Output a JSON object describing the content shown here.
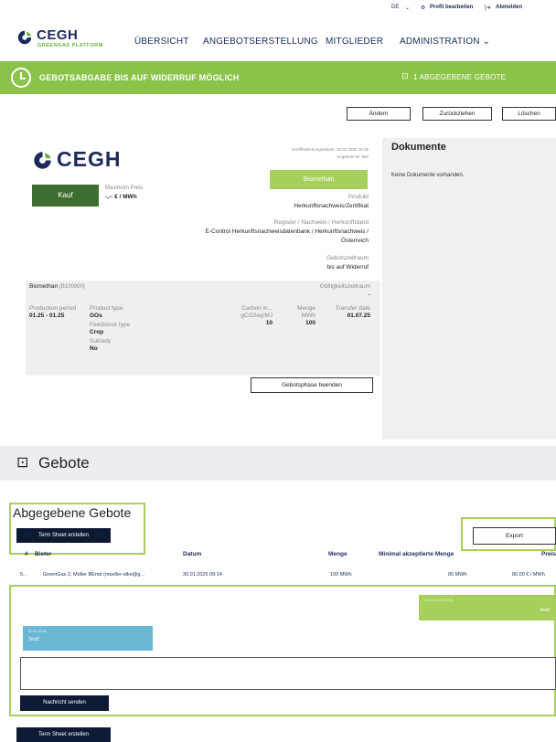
{
  "topbar": {
    "lang": "DE",
    "profile": "Profil bearbeiten",
    "logout": "Abmelden"
  },
  "brand": {
    "name": "CEGH",
    "sub": "GREENGAS PLATFORM",
    "primary": "#1c2a5a",
    "accent": "#8bc34a"
  },
  "nav": [
    "ÜBERSICHT",
    "ANGEBOTSERSTELLUNG",
    "MITGLIEDER",
    "ADMINISTRATION"
  ],
  "banner": {
    "title": "GEBOTSABGABE BIS AUF WIDERRUF MÖGLICH",
    "bids": "1 ABGEGEBENE GEBOTE"
  },
  "actions": {
    "edit": "Ändern",
    "withdraw": "Zurückziehen",
    "delete": "Löschen"
  },
  "offer": {
    "logo": "CEGH",
    "type": "Kauf",
    "max_price_label": "Maximum Preis",
    "max_price": "-,-- € / MWh",
    "published": "Veröffentlichungsdatum: 30.01.2025 16:39",
    "offer_id": "Angebots ID: 883",
    "product_tag": "Biomethan",
    "product_label": "Produkt",
    "product": "Herkunftsnachweis/Zertifikat",
    "register_label": "Register / Nachweis / Herkunftsland",
    "register_line1": "E-Control Herkunftsnachweisdatenbank / Herkunftsnachweis /",
    "register_line2": "Österreich",
    "bid_period_label": "Gebotszeitraum",
    "bid_period": "bis auf Widerruf",
    "product_name": "Biomethan",
    "product_code": "(B100000)",
    "validity_label": "Gültigkeitszeitraum",
    "validity": "-",
    "production_period_label": "Production period",
    "production_period": "01.25 - 01.25",
    "product_type_label": "Product type",
    "product_type": "GOs",
    "feedstock_label": "Feedstock type",
    "feedstock": "Crop",
    "subsidy_label": "Subsidy",
    "subsidy": "No",
    "carbon_label": "Carbon in...",
    "carbon_unit": "gCO2eq/MJ",
    "carbon": "10",
    "quantity_label": "Menge",
    "quantity_unit": "MWh",
    "quantity": "100",
    "transfer_label": "Transfer date",
    "transfer": "01.07.25",
    "end_phase": "Gebotsphase beenden"
  },
  "documents": {
    "title": "Dokumente",
    "empty": "Keine Dokumente vorhanden."
  },
  "bids_section": {
    "title": "Gebote"
  },
  "submitted": {
    "title": "Abgegebene Gebote",
    "term_sheet": "Term Sheet erstellen",
    "export": "Export",
    "columns": [
      "#",
      "Bieter",
      "Datum",
      "Menge",
      "Minimal akzeptierte Menge",
      "Preis"
    ],
    "rows": [
      [
        "5...",
        "GreenGas 2, Müller BEmd (mueller-elke@g...",
        "30.01.2025 09:14",
        "100 MWh",
        "80 MWh",
        "80,00 € / MWh"
      ]
    ]
  },
  "chat": {
    "msg_right_time": "30.01.2025 09:15",
    "msg_right_text": "Test1",
    "msg_left_time": "30.01.2025",
    "msg_left_text": "Test2",
    "send": "Nachricht senden"
  },
  "footer": {
    "term_sheet": "Term Sheet erstellen"
  }
}
